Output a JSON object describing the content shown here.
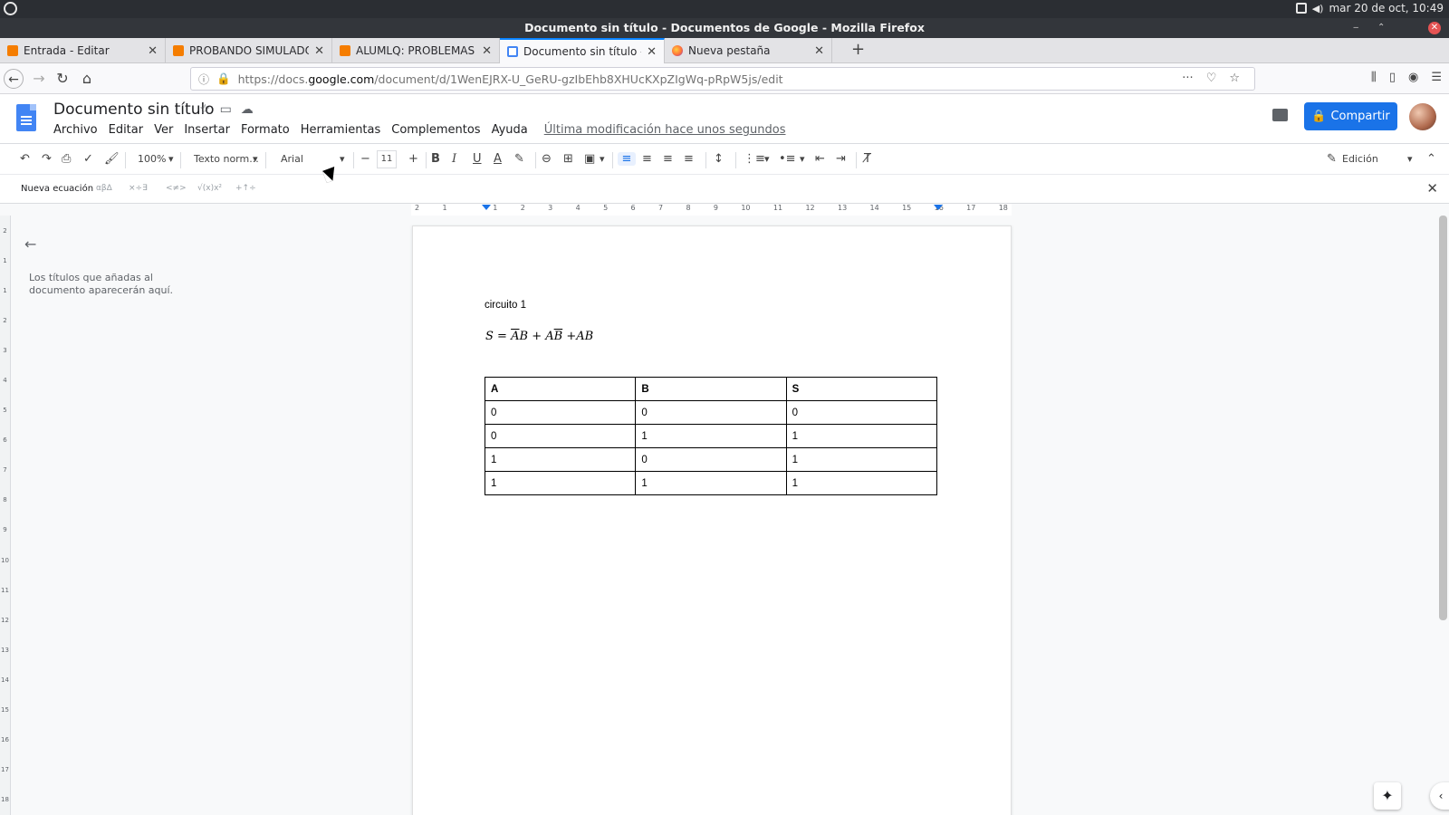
{
  "os": {
    "clock": "mar 20 de oct, 10:49"
  },
  "window": {
    "title": "Documento sin título - Documentos de Google - Mozilla Firefox"
  },
  "tabs": [
    {
      "label": "Entrada - Editar",
      "icon": "blogger-icon"
    },
    {
      "label": "PROBANDO SIMULADO",
      "icon": "blogger-icon"
    },
    {
      "label": "ALUMLQ: PROBLEMAS",
      "icon": "blogger-icon"
    },
    {
      "label": "Documento sin título - D",
      "icon": "docs-icon",
      "active": true
    },
    {
      "label": "Nueva pestaña",
      "icon": "firefox-icon"
    }
  ],
  "address": {
    "url_prefix": "https://docs.",
    "url_domain": "google.com",
    "url_path": "/document/d/1WenEJRX-U_GeRU-gzIbEhb8XHUcKXpZIgWq-pRpW5js/edit"
  },
  "docs": {
    "title": "Documento sin título",
    "menu": [
      "Archivo",
      "Editar",
      "Ver",
      "Insertar",
      "Formato",
      "Herramientas",
      "Complementos",
      "Ayuda"
    ],
    "last_edit": "Última modificación hace unos segundos",
    "share_label": "Compartir",
    "accent": "#1a73e8"
  },
  "toolbar": {
    "zoom": "100%",
    "style": "Texto norm...",
    "font": "Arial",
    "size": "11",
    "mode": "Edición"
  },
  "equation_bar": {
    "new_equation": "Nueva ecuación",
    "groups": [
      "αβΔ",
      "×÷∃",
      "<≠>",
      "√(x)x²",
      "+↑÷"
    ]
  },
  "ruler": {
    "ticks": [
      "2",
      "1",
      "",
      "1",
      "2",
      "3",
      "4",
      "5",
      "6",
      "7",
      "8",
      "9",
      "10",
      "11",
      "12",
      "13",
      "14",
      "15",
      "16",
      "17",
      "18"
    ]
  },
  "outline": {
    "placeholder": "Los títulos que añadas al documento aparecerán aquí."
  },
  "document": {
    "heading_text": "circuito 1",
    "equation": {
      "s": "S",
      "eq": "=",
      "a1": "A",
      "b1": "B",
      "plus1": "+",
      "a2": "A",
      "b2": "B",
      "plus2": "+",
      "ab": "AB"
    },
    "table": {
      "headers": [
        "A",
        "B",
        "S"
      ],
      "rows": [
        [
          "0",
          "0",
          "0"
        ],
        [
          "0",
          "1",
          "1"
        ],
        [
          "1",
          "0",
          "1"
        ],
        [
          "1",
          "1",
          "1"
        ]
      ]
    }
  }
}
